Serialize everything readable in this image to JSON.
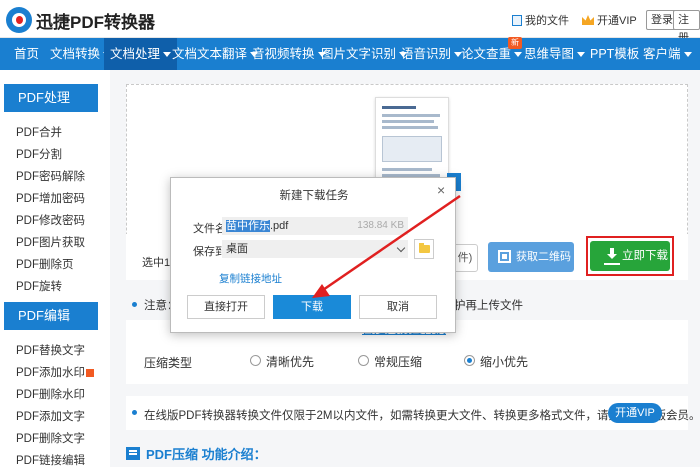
{
  "header": {
    "brand": "迅捷PDF转换器",
    "my_files": "我的文件",
    "vip": "开通VIP",
    "login": "登录",
    "register": "注册"
  },
  "nav": {
    "items": [
      "首页",
      "文档转换",
      "文档处理",
      "文档文本翻译",
      "音视频转换",
      "图片文字识别",
      "语音识别",
      "论文查重",
      "思维导图",
      "PPT模板",
      "客户端"
    ],
    "badge": "新"
  },
  "sidebar": {
    "section1_title": "PDF处理",
    "section1_items": [
      "PDF合并",
      "PDF分割",
      "PDF密码解除",
      "PDF增加密码",
      "PDF修改密码",
      "PDF图片获取",
      "PDF删除页",
      "PDF旋转"
    ],
    "section2_title": "PDF编辑",
    "section2_items": [
      "PDF替换文字",
      "PDF添加水印",
      "PDF删除水印",
      "PDF添加文字",
      "PDF删除文字",
      "PDF链接编辑"
    ]
  },
  "main": {
    "selected_text": "选中1个",
    "ghost_btn": "件)",
    "qr_btn": "获取二维码",
    "download_btn": "立即下载",
    "notice_label": "注意：",
    "notice_tail": "护再上传文件",
    "compress_link": "自定义设置转换",
    "compress_label": "压缩类型",
    "compress_options": [
      "清晰优先",
      "常规压缩",
      "缩小优先"
    ],
    "compress_selected": "缩小优先",
    "info_text": "在线版PDF转换器转换文件仅限于2M以内文件，如需转换更大文件、转换更多格式文件，请开通在线版会员。",
    "vip_pill": "开通VIP",
    "intro_title": "PDF压缩 功能介绍："
  },
  "dialog": {
    "title": "新建下载任务",
    "close": "×",
    "fname_label": "文件名",
    "fname_highlight": "苗中作乐",
    "fname_ext": ".pdf",
    "fsize": "138.84 KB",
    "dir_label": "保存到",
    "dir_value": "桌面",
    "copy_link": "复制链接地址",
    "btn_open": "直接打开",
    "btn_download": "下载",
    "btn_cancel": "取消"
  },
  "colors": {
    "accent": "#1a7fd0",
    "download_green": "#27a53a",
    "highlight_red": "#e02020"
  }
}
